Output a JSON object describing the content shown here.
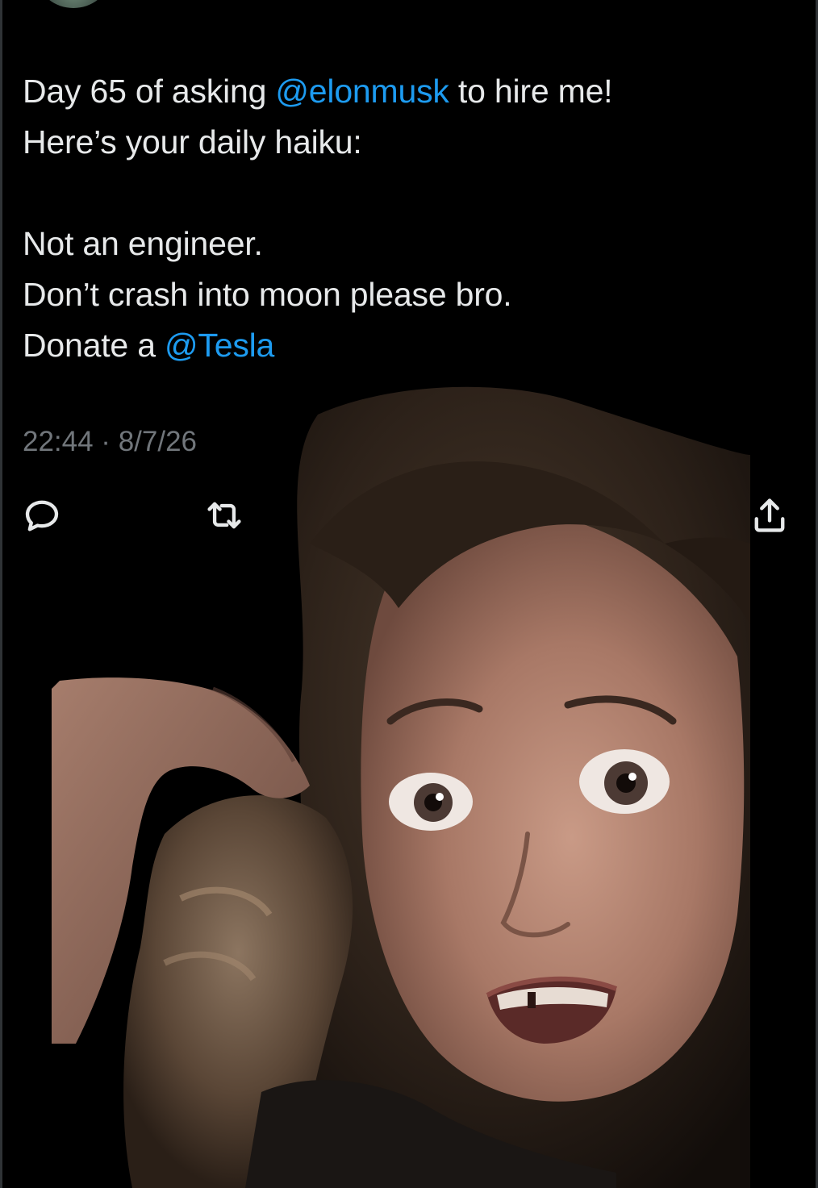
{
  "tweet": {
    "line1_prefix": "Day 65 of asking ",
    "line1_mention": "@elonmusk",
    "line1_suffix": " to hire me!",
    "line2": "Here’s your daily haiku:",
    "haiku_line1": "Not an engineer.",
    "haiku_line2": "Don’t crash into moon please bro.",
    "haiku_line3_prefix": "Donate a ",
    "haiku_line3_mention": "@Tesla",
    "timestamp": "22:44 · 8/7/26"
  },
  "actions": {
    "reply_icon": "reply-icon",
    "retweet_icon": "retweet-icon",
    "share_icon": "share-icon"
  },
  "colors": {
    "background": "#000000",
    "text": "#e7e9ea",
    "mention": "#1d9bf0",
    "muted": "#71767b"
  }
}
